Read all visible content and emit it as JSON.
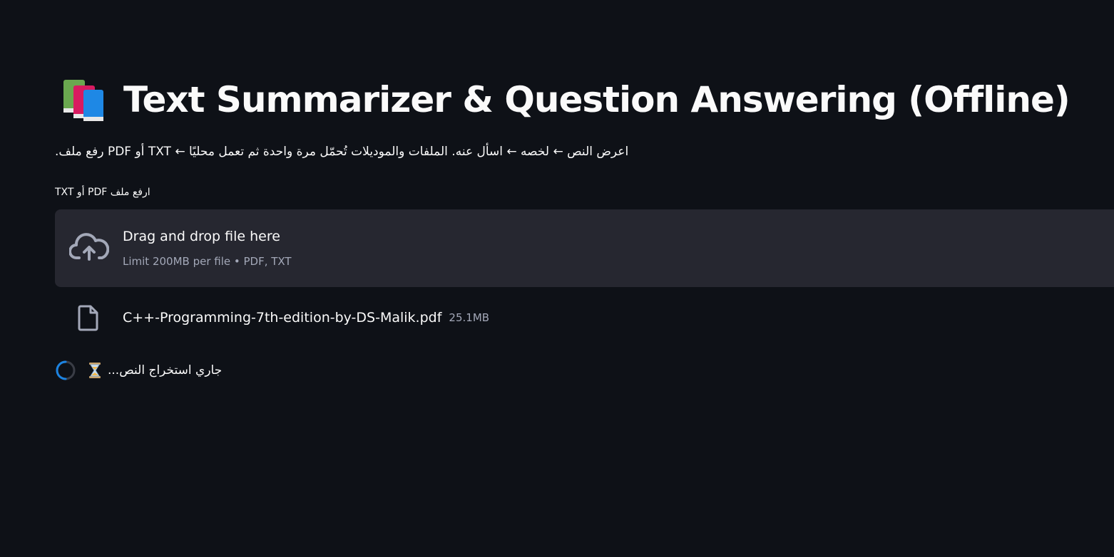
{
  "title": {
    "icon": "books-icon",
    "text": "Text Summarizer & Question Answering (Offline)"
  },
  "subtitle": "اعرض النص ← لخصه ← اسأل عنه. الملفات والموديلات تُحمّل مرة واحدة ثم تعمل محليًا ← TXT أو PDF رفع ملف.",
  "uploader": {
    "label": "ارفع ملف PDF أو TXT",
    "icon": "cloud-upload-icon",
    "dropzone_title": "Drag and drop file here",
    "dropzone_limit": "Limit 200MB per file • PDF, TXT"
  },
  "uploaded_file": {
    "icon": "file-icon",
    "name": "C++-Programming-7th-edition-by-DS-Malik.pdf",
    "size": "25.1MB"
  },
  "status": {
    "icon": "hourglass-icon",
    "text": "جاري استخراج النص..."
  },
  "colors": {
    "background": "#0e1117",
    "panel": "#262730",
    "text": "#fafafa",
    "muted": "#a3a8b8",
    "spinner_accent": "#1c83e1"
  }
}
